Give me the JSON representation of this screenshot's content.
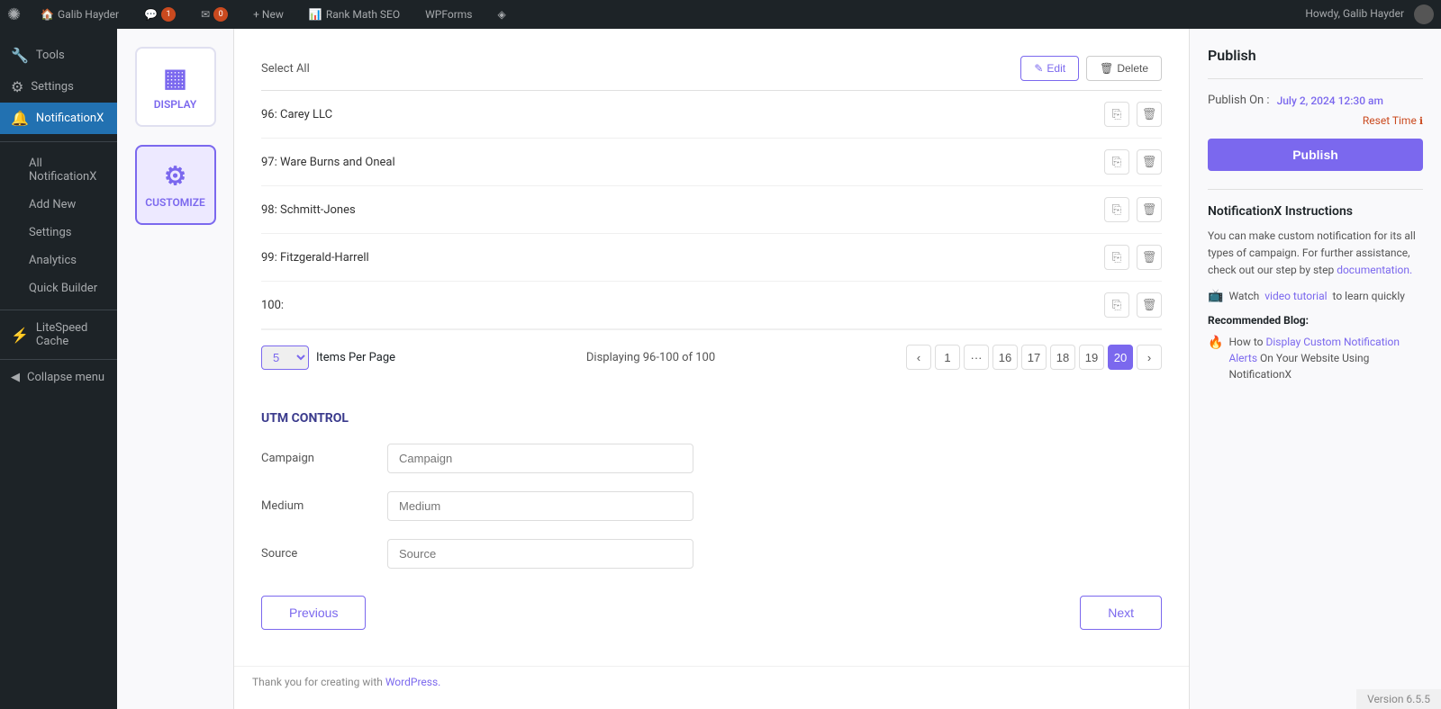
{
  "adminbar": {
    "logo": "✺",
    "site_name": "Galib Hayder",
    "comments_count": "1",
    "messages_count": "0",
    "new_label": "+ New",
    "rank_math": "Rank Math SEO",
    "wpforms": "WPForms",
    "diamond_icon": "◈",
    "howdy": "Howdy, Galib Hayder"
  },
  "sidebar": {
    "tools_label": "Tools",
    "settings_label": "Settings",
    "notificationx_label": "NotificationX",
    "all_notifications_label": "All NotificationX",
    "add_new_label": "Add New",
    "settings_sub_label": "Settings",
    "analytics_label": "Analytics",
    "quick_builder_label": "Quick Builder",
    "litespeed_label": "LiteSpeed Cache",
    "collapse_label": "Collapse menu"
  },
  "left_panel": {
    "display_label": "DISPLAY",
    "customize_label": "CUSTOMIZE",
    "customize_icon": "⚙"
  },
  "table": {
    "select_all": "Select All",
    "edit_label": "Edit",
    "delete_label": "Delete",
    "rows": [
      {
        "id": "96",
        "name": "Carey LLC"
      },
      {
        "id": "97",
        "name": "Ware Burns and Oneal"
      },
      {
        "id": "98",
        "name": "Schmitt-Jones"
      },
      {
        "id": "99",
        "name": "Fitzgerald-Harrell"
      },
      {
        "id": "100",
        "name": ""
      }
    ],
    "items_per_page_label": "Items Per Page",
    "per_page_value": "5",
    "displaying": "Displaying 96-100 of 100",
    "pages": [
      "1",
      "...",
      "16",
      "17",
      "18",
      "19",
      "20"
    ],
    "active_page": "20"
  },
  "utm_control": {
    "title": "UTM CONTROL",
    "campaign_label": "Campaign",
    "campaign_placeholder": "Campaign",
    "medium_label": "Medium",
    "medium_placeholder": "Medium",
    "source_label": "Source",
    "source_placeholder": "Source"
  },
  "navigation": {
    "previous_label": "Previous",
    "next_label": "Next"
  },
  "footer": {
    "thank_you_text": "Thank you for creating with",
    "wordpress_link": "WordPress.",
    "version": "Version 6.5.5"
  },
  "right_panel": {
    "publish_title": "Publish",
    "publish_on_label": "Publish On :",
    "publish_date": "July 2, 2024 12:30 am",
    "reset_time_label": "Reset Time",
    "publish_button": "Publish",
    "instructions_title": "NotificationX Instructions",
    "instructions_text": "You can make custom notification for its all types of campaign. For further assistance, check out our step by step",
    "documentation_link": "documentation.",
    "watch_label": "Watch",
    "video_tutorial_link": "video tutorial",
    "to_learn": "to learn quickly",
    "recommended_title": "Recommended Blog:",
    "blog_text_prefix": "How to",
    "blog_link_text": "Display Custom Notification Alerts",
    "blog_text_suffix": "On Your Website Using NotificationX"
  }
}
